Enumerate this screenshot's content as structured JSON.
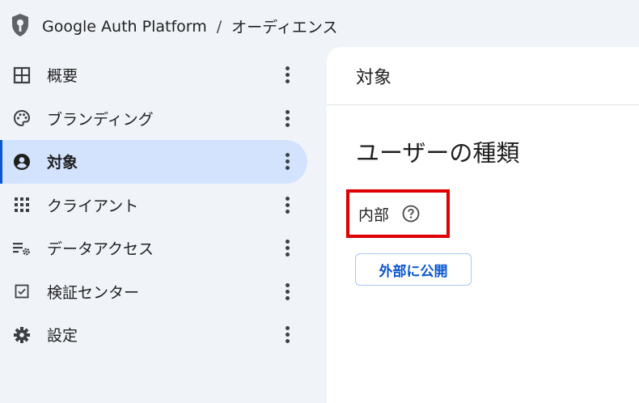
{
  "header": {
    "app_name": "Google Auth Platform",
    "separator": "/",
    "current_page": "オーディエンス"
  },
  "sidebar": {
    "items": [
      {
        "label": "概要",
        "icon": "dashboard-icon",
        "active": false
      },
      {
        "label": "ブランディング",
        "icon": "palette-icon",
        "active": false
      },
      {
        "label": "対象",
        "icon": "account-circle-icon",
        "active": true
      },
      {
        "label": "クライアント",
        "icon": "apps-grid-icon",
        "active": false
      },
      {
        "label": "データアクセス",
        "icon": "data-settings-icon",
        "active": false
      },
      {
        "label": "検証センター",
        "icon": "checkbox-icon",
        "active": false
      },
      {
        "label": "設定",
        "icon": "gear-icon",
        "active": false
      }
    ]
  },
  "main": {
    "header_title": "対象",
    "section_title": "ユーザーの種類",
    "user_type_value": "内部",
    "publish_button_label": "外部に公開"
  },
  "colors": {
    "accent": "#0b57d0",
    "active_bg": "#d3e3fd",
    "highlight_border": "#e00000",
    "page_bg": "#f0f4f9"
  }
}
